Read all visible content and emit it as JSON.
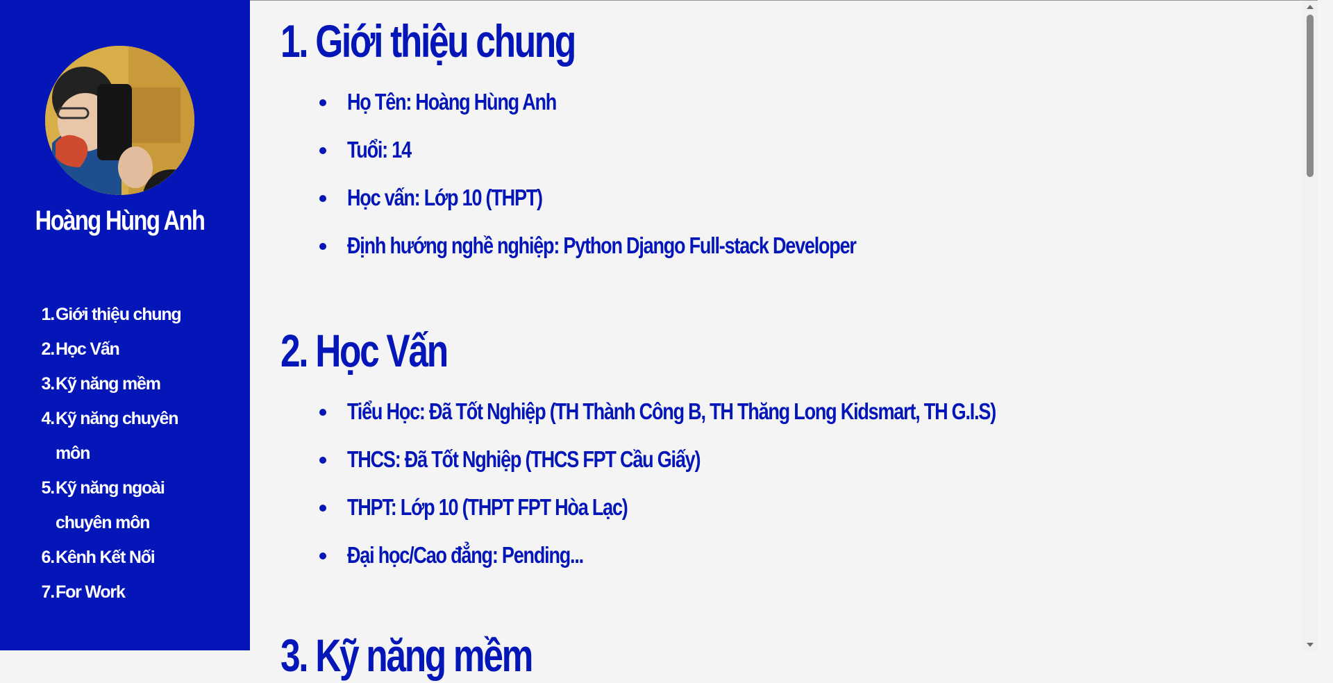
{
  "sidebar": {
    "name": "Hoàng Hùng Anh",
    "nav": [
      {
        "num": "1.",
        "label": "Giới thiệu chung"
      },
      {
        "num": "2.",
        "label": "Học Vấn"
      },
      {
        "num": "3.",
        "label": "Kỹ năng mềm"
      },
      {
        "num": "4.",
        "label": "Kỹ năng chuyên môn"
      },
      {
        "num": "5.",
        "label": "Kỹ năng ngoài chuyên môn"
      },
      {
        "num": "6.",
        "label": "Kênh Kết Nối"
      },
      {
        "num": "7.",
        "label": "For Work"
      }
    ]
  },
  "sections": [
    {
      "title": "1. Giới thiệu chung",
      "items": [
        "Họ Tên: Hoàng Hùng Anh",
        "Tuổi: 14",
        "Học vấn: Lớp 10 (THPT)",
        "Định hướng nghề nghiệp: Python Django Full-stack Developer"
      ]
    },
    {
      "title": "2. Học Vấn",
      "items": [
        "Tiểu Học: Đã Tốt Nghiệp (TH Thành Công B, TH Thăng Long Kidsmart, TH G.I.S)",
        "THCS: Đã Tốt Nghiệp (THCS FPT Cầu Giấy)",
        "THPT: Lớp 10 (THPT FPT Hòa Lạc)",
        "Đại học/Cao đẳng: Pending..."
      ]
    },
    {
      "title": "3. Kỹ năng mềm"
    }
  ],
  "colors": {
    "sidebar_bg": "#0416b8",
    "accent": "#0416b8",
    "page_bg": "#f4f4f4"
  }
}
